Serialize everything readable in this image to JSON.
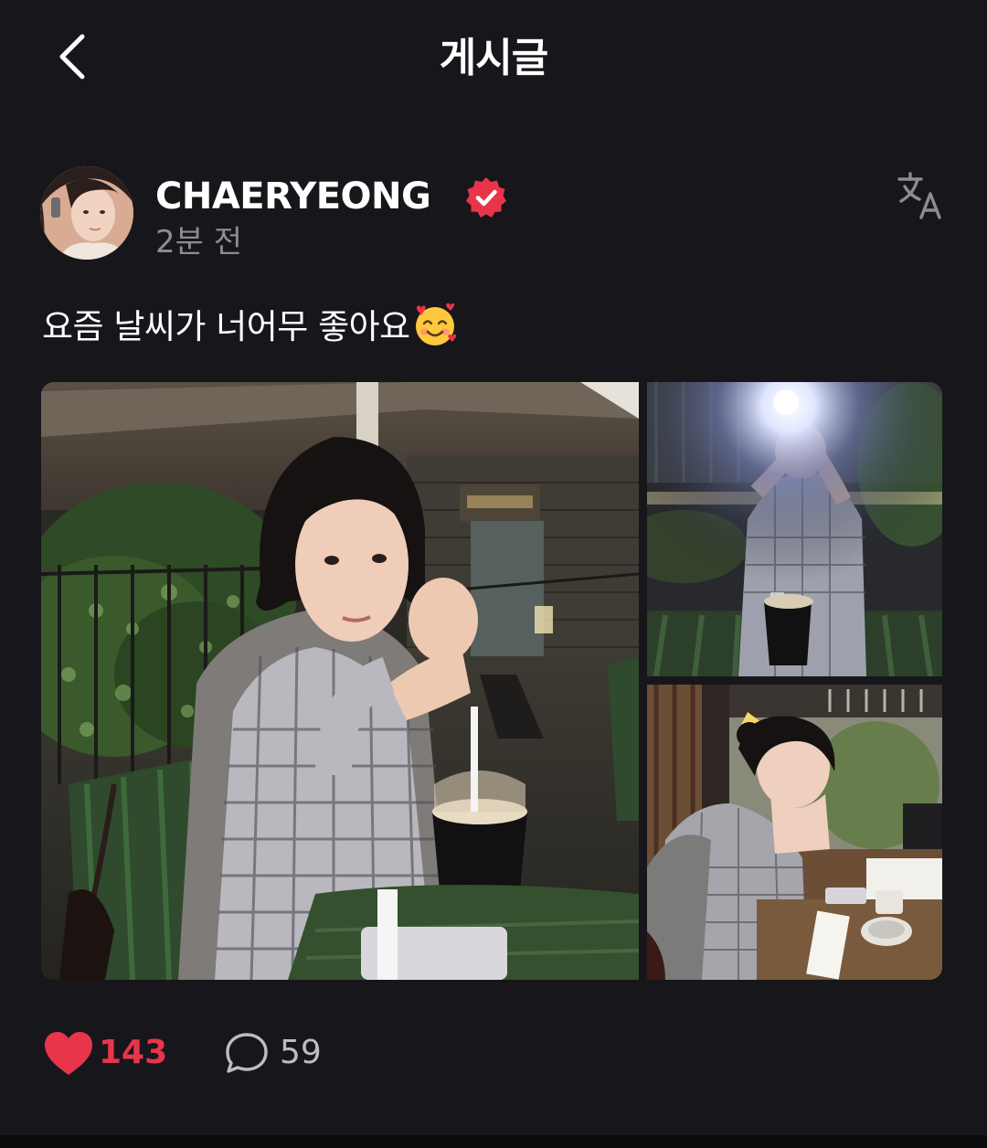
{
  "header": {
    "title": "게시글",
    "back_icon": "chevron-left-icon"
  },
  "author": {
    "name": "CHAERYEONG",
    "verified": true,
    "verified_color": "#e8354a",
    "time": "2분 전",
    "translate_icon": "translate-icon"
  },
  "post": {
    "text": "요즘 날씨가 너어무 좋아요",
    "emoji": "smiling-face-with-hearts-emoji",
    "photos": [
      {
        "label": "photo-main"
      },
      {
        "label": "photo-top-right"
      },
      {
        "label": "photo-bottom-right"
      }
    ]
  },
  "actions": {
    "like_count": "143",
    "like_color": "#e8354a",
    "comment_count": "59"
  },
  "colors": {
    "background": "#17161b",
    "secondary_text": "#8d8c92"
  }
}
